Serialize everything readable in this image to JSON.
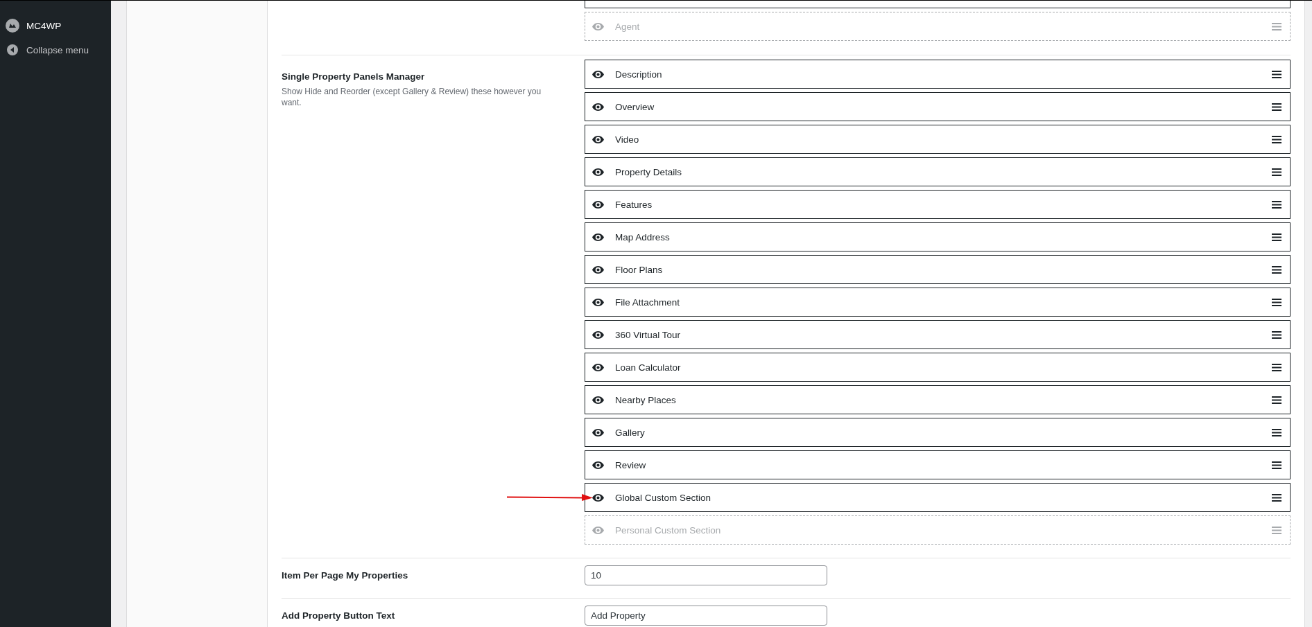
{
  "sidebar": {
    "items": [
      {
        "label": "MC4WP",
        "kind": "plugin"
      },
      {
        "label": "Collapse menu",
        "kind": "collapse"
      }
    ]
  },
  "sections": [
    {
      "kind": "panels",
      "partial_row_above": true,
      "panels": [
        {
          "label": "Agent",
          "enabled": false,
          "arrow": false
        }
      ]
    },
    {
      "kind": "panels",
      "title": "Single Property Panels Manager",
      "description": "Show Hide and Reorder (except Gallery & Review) these however you want.",
      "panels": [
        {
          "label": "Description",
          "enabled": true,
          "arrow": false
        },
        {
          "label": "Overview",
          "enabled": true,
          "arrow": false
        },
        {
          "label": "Video",
          "enabled": true,
          "arrow": false
        },
        {
          "label": "Property Details",
          "enabled": true,
          "arrow": false
        },
        {
          "label": "Features",
          "enabled": true,
          "arrow": false
        },
        {
          "label": "Map Address",
          "enabled": true,
          "arrow": false
        },
        {
          "label": "Floor Plans",
          "enabled": true,
          "arrow": false
        },
        {
          "label": "File Attachment",
          "enabled": true,
          "arrow": false
        },
        {
          "label": "360 Virtual Tour",
          "enabled": true,
          "arrow": false
        },
        {
          "label": "Loan Calculator",
          "enabled": true,
          "arrow": false
        },
        {
          "label": "Nearby Places",
          "enabled": true,
          "arrow": false
        },
        {
          "label": "Gallery",
          "enabled": true,
          "arrow": false
        },
        {
          "label": "Review",
          "enabled": true,
          "arrow": false
        },
        {
          "label": "Global Custom Section",
          "enabled": true,
          "arrow": true
        },
        {
          "label": "Personal Custom Section",
          "enabled": false,
          "arrow": false
        }
      ]
    },
    {
      "kind": "input",
      "title": "Item Per Page My Properties",
      "value": "10"
    },
    {
      "kind": "input",
      "title": "Add Property Button Text",
      "value": "Add Property"
    }
  ]
}
